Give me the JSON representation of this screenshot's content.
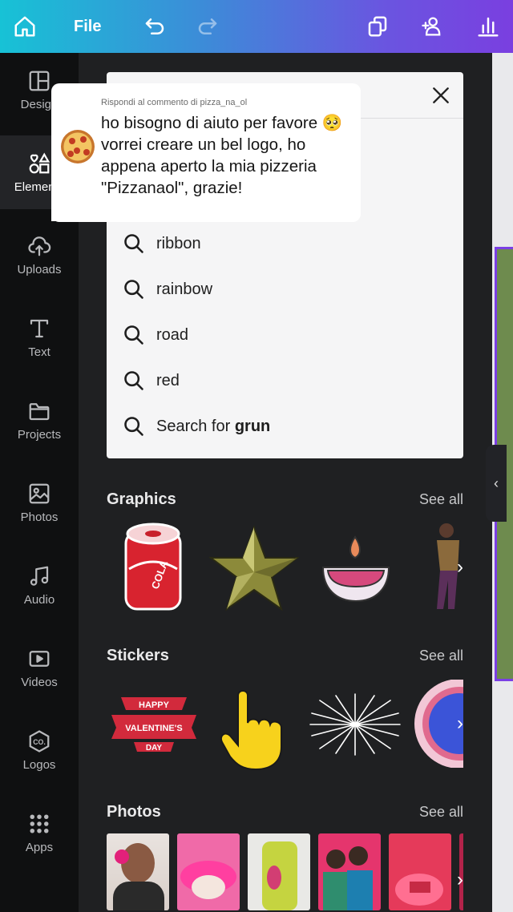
{
  "topbar": {
    "file_label": "File"
  },
  "sidebar": {
    "items": [
      {
        "label": "Design",
        "icon": "layout-icon"
      },
      {
        "label": "Elements",
        "icon": "shapes-icon"
      },
      {
        "label": "Uploads",
        "icon": "cloud-upload-icon"
      },
      {
        "label": "Text",
        "icon": "text-icon"
      },
      {
        "label": "Projects",
        "icon": "folder-icon"
      },
      {
        "label": "Photos",
        "icon": "image-icon"
      },
      {
        "label": "Audio",
        "icon": "music-icon"
      },
      {
        "label": "Videos",
        "icon": "video-icon"
      },
      {
        "label": "Logos",
        "icon": "logo-icon"
      },
      {
        "label": "Apps",
        "icon": "apps-grid-icon"
      }
    ]
  },
  "search": {
    "suggestions": [
      "ribbon",
      "rainbow",
      "road",
      "red"
    ],
    "search_for_prefix": "Search for ",
    "search_for_term": "grun"
  },
  "comment": {
    "header": "Rispondi al commento di pizza_na_ol",
    "text": "ho bisogno di aiuto per favore 🥺 vorrei creare un bel logo, ho appena aperto la mia pizzeria \"Pizzanaol\", grazie!"
  },
  "sections": {
    "graphics": {
      "title": "Graphics",
      "see_all": "See all"
    },
    "stickers": {
      "title": "Stickers",
      "see_all": "See all"
    },
    "photos": {
      "title": "Photos",
      "see_all": "See all"
    }
  },
  "graphics_items": {
    "cola_text": "COLA"
  },
  "sticker_items": {
    "ribbon_line1": "HAPPY",
    "ribbon_line2": "VALENTINE'S",
    "ribbon_line3": "DAY"
  },
  "colors": {
    "accent": "#7b3fe4",
    "topbar_start": "#17c2d6",
    "topbar_end": "#7a3fe0"
  }
}
